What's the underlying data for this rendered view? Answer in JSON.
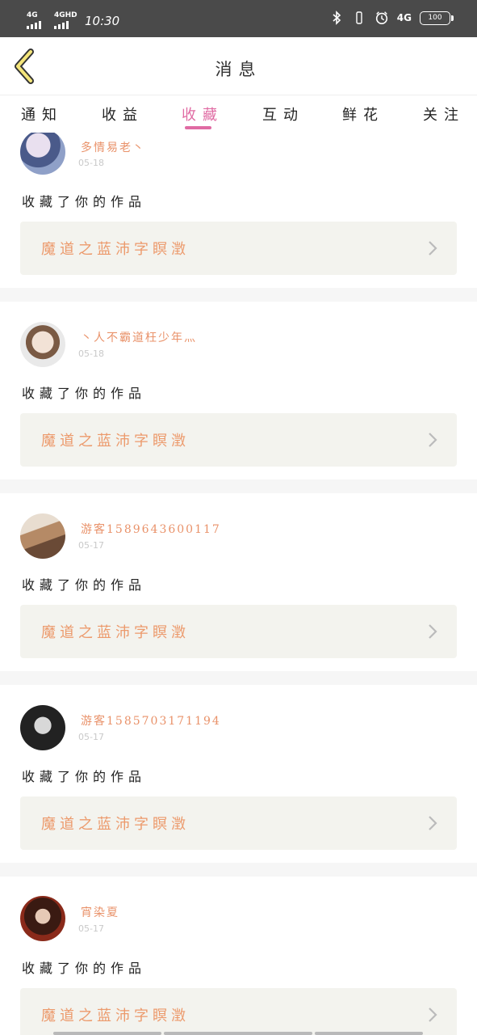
{
  "status_bar": {
    "signal_1": "4G",
    "signal_2": "4GHD",
    "time": "10:30",
    "network": "4G",
    "battery": "100"
  },
  "header": {
    "title": "消息"
  },
  "tabs": [
    {
      "label": "通知"
    },
    {
      "label": "收益"
    },
    {
      "label": "收藏"
    },
    {
      "label": "互动"
    },
    {
      "label": "鲜花"
    },
    {
      "label": "关注"
    }
  ],
  "active_tab": "收藏",
  "colors": {
    "accent": "#e06ba3",
    "username": "#e9926a",
    "work_title": "#ec9a6c",
    "work_bg": "#f3f3ee",
    "status_bar": "#4a4a4a"
  },
  "messages": [
    {
      "username": "多情易老丶",
      "date": "05-18",
      "action": "收藏了你的作品",
      "work_title": "魔道之蓝沛字瞑澂"
    },
    {
      "username": "丶人不霸道枉少年灬",
      "date": "05-18",
      "action": "收藏了你的作品",
      "work_title": "魔道之蓝沛字瞑澂"
    },
    {
      "username": "游客1589643600117",
      "date": "05-17",
      "action": "收藏了你的作品",
      "work_title": "魔道之蓝沛字瞑澂"
    },
    {
      "username": "游客1585703171194",
      "date": "05-17",
      "action": "收藏了你的作品",
      "work_title": "魔道之蓝沛字瞑澂"
    },
    {
      "username": "宵染夏",
      "date": "05-17",
      "action": "收藏了你的作品",
      "work_title": "魔道之蓝沛字瞑澂"
    }
  ]
}
